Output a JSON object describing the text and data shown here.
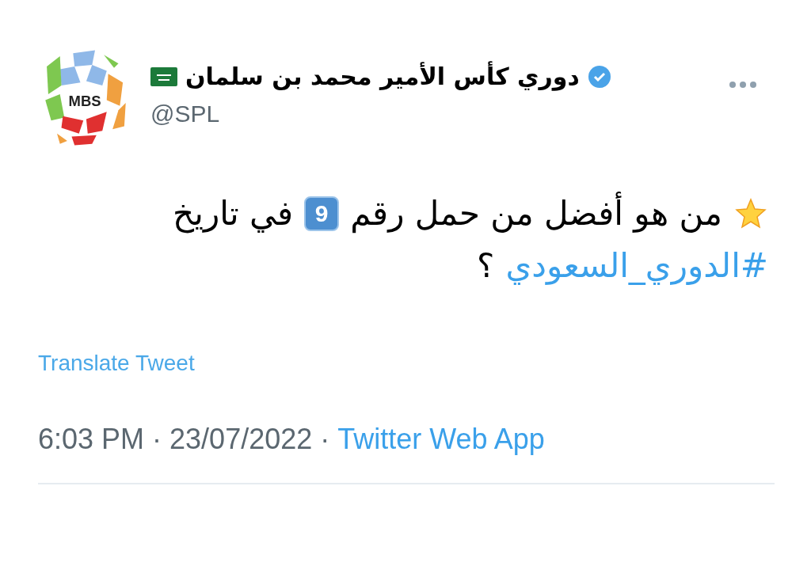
{
  "author": {
    "logo_text": "MBS",
    "name": "دوري كأس الأمير محمد بن سلمان",
    "handle": "@SPL"
  },
  "tweet": {
    "lines": [
      [
        {
          "kind": "emoji"
        },
        {
          "kind": "text",
          "text": "من هو أفضل من حمل رقم"
        },
        {
          "kind": "keycap",
          "text": "9"
        },
        {
          "kind": "text",
          "text": "في تاريخ"
        }
      ],
      [
        {
          "kind": "hashtag",
          "text": "#الدوري_السعودي"
        },
        {
          "kind": "text",
          "text": "؟"
        }
      ]
    ]
  },
  "translate": "Translate Tweet",
  "meta": {
    "time": "6:03 PM · 23/07/2022 ·",
    "source": "Twitter Web App"
  }
}
